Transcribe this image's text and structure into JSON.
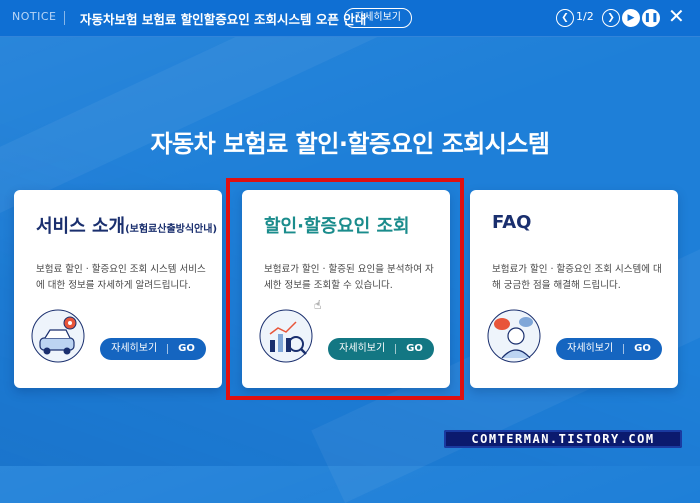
{
  "notice": {
    "label": "NOTICE",
    "text": "자동차보험 보험료 할인할증요인 조회시스템 오픈 안내",
    "detail_button": "자세히보기",
    "pager": "1/2",
    "prev_icon": "chevron-left-icon",
    "next_icon": "chevron-right-icon",
    "play_icon": "play-icon",
    "pause_icon": "pause-icon",
    "close_icon": "close-icon"
  },
  "main": {
    "title": "자동차 보험료 할인·할증요인 조회시스템"
  },
  "cards": [
    {
      "title": "서비스 소개",
      "title_sub": "(보험료산출방식안내)",
      "desc": "보험료 할인 · 할증요인 조회 시스템 서비스에 대한 정보를 자세하게 알려드립니다.",
      "button": "자세히보기",
      "go": "GO",
      "icon": "car-gear-icon"
    },
    {
      "title": "할인·할증요인 조회",
      "title_sub": "",
      "desc": "보험료가 할인 · 할증된 요인을 분석하여 자세한 정보를 조회할 수 있습니다.",
      "button": "자세히보기",
      "go": "GO",
      "icon": "chart-magnifier-icon"
    },
    {
      "title": "FAQ",
      "title_sub": "",
      "desc": "보험료가 할인 · 할증요인 조회 시스템에 대해 궁금한 점을 해결해 드립니다.",
      "button": "자세히보기",
      "go": "GO",
      "icon": "person-chat-icon"
    }
  ],
  "watermark": "COMTERMAN.TISTORY.COM",
  "colors": {
    "background": "#1e7fd8",
    "notice_bar": "#0f6fd3",
    "card_button_blue": "#1565c0",
    "card_button_teal": "#137783",
    "highlight": "#e01010"
  }
}
